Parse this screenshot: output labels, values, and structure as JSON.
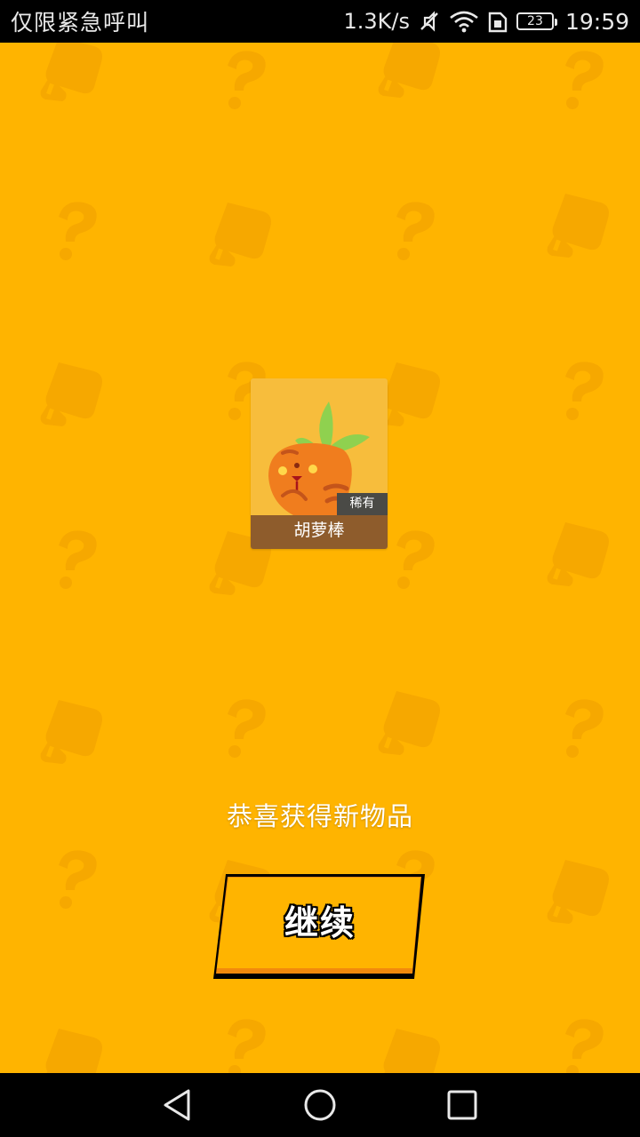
{
  "status_bar": {
    "carrier": "仅限紧急呼叫",
    "net_speed": "1.3K/s",
    "battery": "23",
    "time": "19:59",
    "icons": [
      "mute-icon",
      "wifi-icon",
      "sim-icon",
      "battery-icon"
    ]
  },
  "item": {
    "name": "胡萝棒",
    "rarity": "稀有",
    "icon": "carrot-creature-icon"
  },
  "message": "恭喜获得新物品",
  "continue_button": {
    "label": "继续"
  },
  "nav_bar": {
    "icons": [
      "back-icon",
      "home-icon",
      "recent-apps-icon"
    ]
  },
  "colors": {
    "background": "#ffb400",
    "card": "#f7bd3c",
    "name_bar": "#8e5c2c",
    "badge": "#4a4a46",
    "carrot": "#f07d1e",
    "leaf": "#8fd14f"
  }
}
